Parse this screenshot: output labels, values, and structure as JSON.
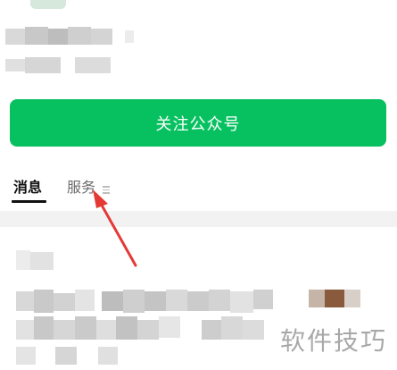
{
  "profile": {
    "follow_label": "关注公众号"
  },
  "tabs": [
    {
      "label": "消息",
      "active": true
    },
    {
      "label": "服务",
      "active": false
    }
  ],
  "watermark": "软件技巧",
  "colors": {
    "accent": "#07c160",
    "annotation_arrow": "#e53935",
    "band": "#f2f2f2"
  },
  "icons": {
    "services_menu": "menu-lines-icon",
    "annotation": "red-arrow-icon"
  }
}
